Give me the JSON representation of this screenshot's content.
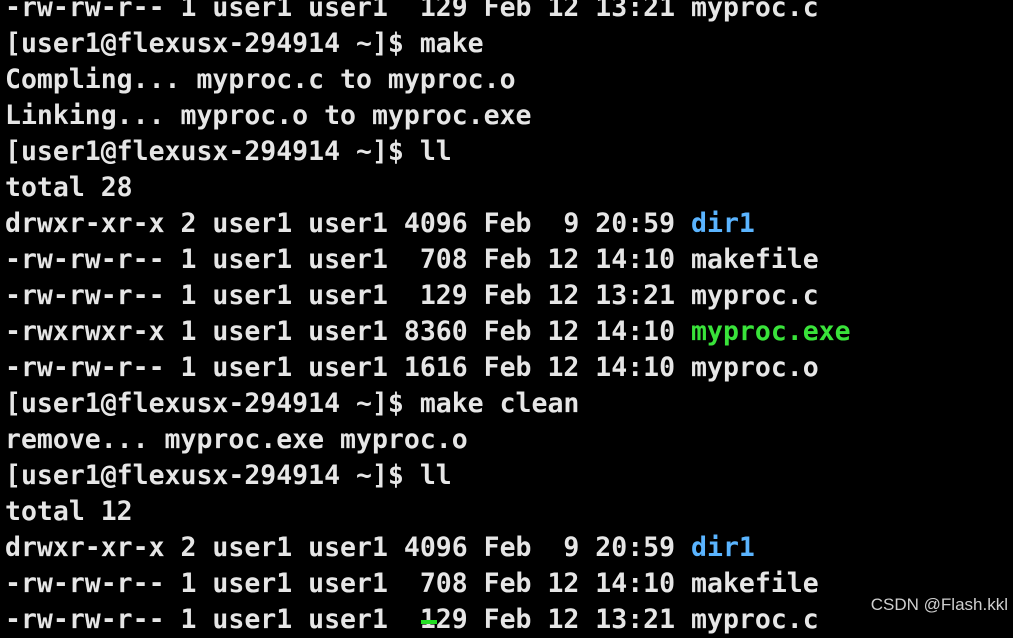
{
  "terminal": {
    "lines": [
      "-rw-rw-r-- 1 user1 user1  129 Feb 12 13:21 myproc.c",
      "[user1@flexusx-294914 ~]$ make",
      "Compling... myproc.c to myproc.o",
      "Linking... myproc.o to myproc.exe",
      "[user1@flexusx-294914 ~]$ ll",
      "total 28",
      {
        "prefix": "drwxr-xr-x 2 user1 user1 4096 Feb  9 20:59 ",
        "name": "dir1",
        "kind": "dir"
      },
      {
        "prefix": "-rw-rw-r-- 1 user1 user1  708 Feb 12 14:10 ",
        "name": "makefile",
        "kind": "file"
      },
      {
        "prefix": "-rw-rw-r-- 1 user1 user1  129 Feb 12 13:21 ",
        "name": "myproc.c",
        "kind": "file"
      },
      {
        "prefix": "-rwxrwxr-x 1 user1 user1 8360 Feb 12 14:10 ",
        "name": "myproc.exe",
        "kind": "exe"
      },
      {
        "prefix": "-rw-rw-r-- 1 user1 user1 1616 Feb 12 14:10 ",
        "name": "myproc.o",
        "kind": "file"
      },
      "[user1@flexusx-294914 ~]$ make clean",
      "remove... myproc.exe myproc.o",
      "[user1@flexusx-294914 ~]$ ll",
      "total 12",
      {
        "prefix": "drwxr-xr-x 2 user1 user1 4096 Feb  9 20:59 ",
        "name": "dir1",
        "kind": "dir"
      },
      {
        "prefix": "-rw-rw-r-- 1 user1 user1  708 Feb 12 14:10 ",
        "name": "makefile",
        "kind": "file"
      },
      {
        "prefix": "-rw-rw-r-- 1 user1 user1  129 Feb 12 13:21 ",
        "name": "myproc.c",
        "kind": "file"
      }
    ]
  },
  "watermark": {
    "text": "CSDN @Flash.kkl"
  },
  "colors": {
    "background": "#000000",
    "text": "#e6e6e6",
    "directory": "#5ab4ff",
    "executable": "#39e33a",
    "cursor": "#22dd22"
  }
}
